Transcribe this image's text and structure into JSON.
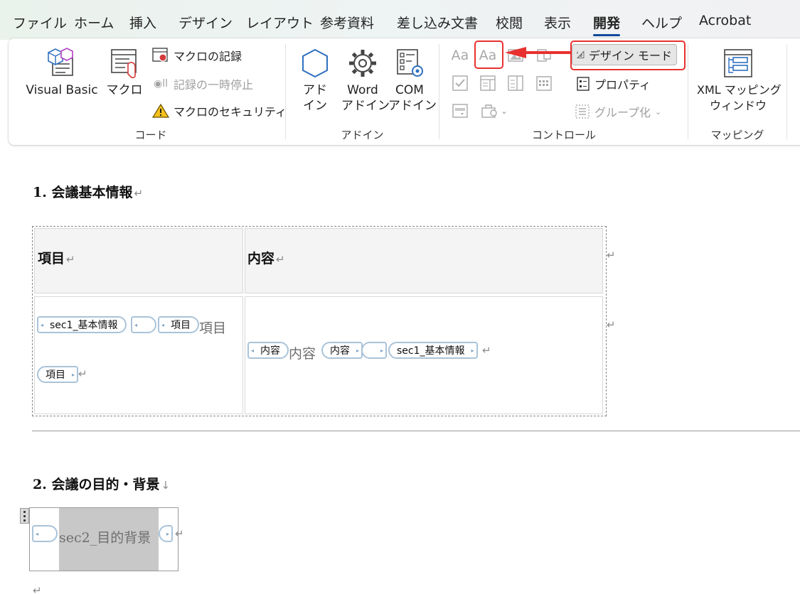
{
  "tabs": [
    {
      "label": "ファイル",
      "active": false
    },
    {
      "label": "ホーム",
      "active": false
    },
    {
      "label": "挿入",
      "active": false
    },
    {
      "label": "デザイン",
      "active": false
    },
    {
      "label": "レイアウト",
      "active": false
    },
    {
      "label": "参考資料",
      "active": false
    },
    {
      "label": "差し込み文書",
      "active": false
    },
    {
      "label": "校閲",
      "active": false
    },
    {
      "label": "表示",
      "active": false
    },
    {
      "label": "開発",
      "active": true
    },
    {
      "label": "ヘルプ",
      "active": false
    },
    {
      "label": "Acrobat",
      "active": false
    }
  ],
  "ribbon": {
    "code": {
      "group_label": "コード",
      "visual_basic": "Visual Basic",
      "macro": "マクロ",
      "record_macro": "マクロの記録",
      "pause_recording": "記録の一時停止",
      "macro_security": "マクロのセキュリティ"
    },
    "addins": {
      "group_label": "アドイン",
      "addin_line1": "アド",
      "addin_line2": "イン",
      "word_addin_line1": "Word",
      "word_addin_line2": "アドイン",
      "com_addin_line1": "COM",
      "com_addin_line2": "アドイン"
    },
    "controls": {
      "group_label": "コントロール",
      "rich_text_glyph": "Aa",
      "plain_text_glyph": "Aa",
      "design_mode": "デザイン モード",
      "properties": "プロパティ",
      "group": "グループ化"
    },
    "mapping": {
      "group_label": "マッピング",
      "xml_line1": "XML マッピング",
      "xml_line2": "ウィンドウ"
    }
  },
  "colors": {
    "accent": "#124a9c",
    "highlight_red": "#e8312f",
    "tag_border": "#a9c3d9"
  },
  "document": {
    "section1": {
      "heading": "1.  会議基本情報",
      "header_item": "項目",
      "header_content": "内容",
      "tag_sec1": "sec1_基本情報",
      "tag_item": "項目",
      "placeholder_item": "項目",
      "tag_item_end": "項目",
      "tag_content": "内容",
      "placeholder_content": "内容",
      "tag_content_end": "内容",
      "tag_sec1_end": "sec1_基本情報"
    },
    "section2": {
      "heading": "2.  会議の目的・背景",
      "placeholder": "sec2_目的背景"
    },
    "paragraph_mark": "↵",
    "line_break_mark": "↓"
  }
}
